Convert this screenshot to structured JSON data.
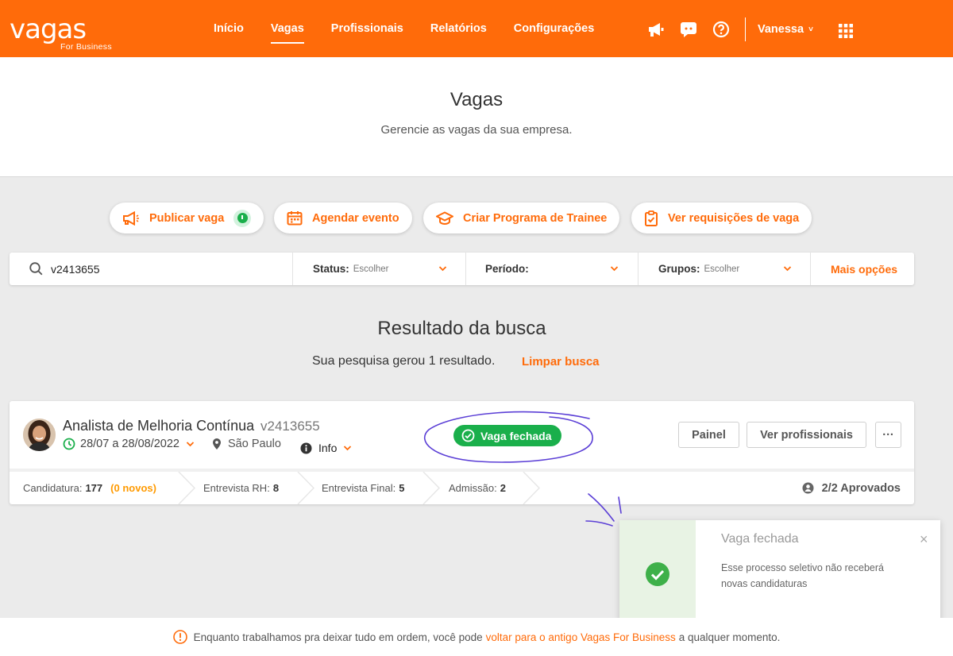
{
  "brand": {
    "name": "vagas",
    "sub": "For Business",
    "accent": "#ff6b0a",
    "success": "#1aaf4b"
  },
  "nav": {
    "items": [
      "Início",
      "Vagas",
      "Profissionais",
      "Relatórios",
      "Configurações"
    ],
    "active": "Vagas"
  },
  "topbar": {
    "icons": [
      "megaphone-icon",
      "chat-icon",
      "help-icon",
      "apps-grid-icon"
    ],
    "user": "Vanessa"
  },
  "header": {
    "title": "Vagas",
    "subtitle": "Gerencie as vagas da sua empresa."
  },
  "actions": [
    "Publicar vaga",
    "Agendar evento",
    "Criar Programa de Trainee",
    "Ver requisições de vaga"
  ],
  "filters": {
    "search_value": "v2413655",
    "status": {
      "label": "Status:",
      "value": "Escolher"
    },
    "period": {
      "label": "Período:",
      "value": ""
    },
    "groups": {
      "label": "Grupos:",
      "value": "Escolher"
    },
    "more": "Mais opções"
  },
  "results": {
    "title": "Resultado da busca",
    "summary": "Sua pesquisa gerou 1 resultado.",
    "clear": "Limpar busca"
  },
  "job": {
    "title": "Analista de Melhoria Contínua",
    "code": "v2413655",
    "dates": "28/07 a 28/08/2022",
    "city": "São Paulo",
    "info": "Info",
    "status": "Vaga fechada",
    "buttons": {
      "panel": "Painel",
      "professionals": "Ver profissionais",
      "more": "···"
    },
    "stages": [
      {
        "label": "Candidatura:",
        "count": "177",
        "extra": "(0 novos)"
      },
      {
        "label": "Entrevista RH:",
        "count": "8"
      },
      {
        "label": "Entrevista Final:",
        "count": "5"
      },
      {
        "label": "Admissão:",
        "count": "2"
      }
    ],
    "approved": "2/2 Aprovados"
  },
  "toast": {
    "title": "Vaga fechada",
    "message": "Esse processo seletivo não receberá novas candidaturas",
    "close": "×",
    "progress": 0.66
  },
  "footer": {
    "before": "Enquanto trabalhamos pra deixar tudo em ordem, você pode",
    "link": "voltar para o antigo Vagas For Business",
    "after": "a qualquer momento."
  }
}
